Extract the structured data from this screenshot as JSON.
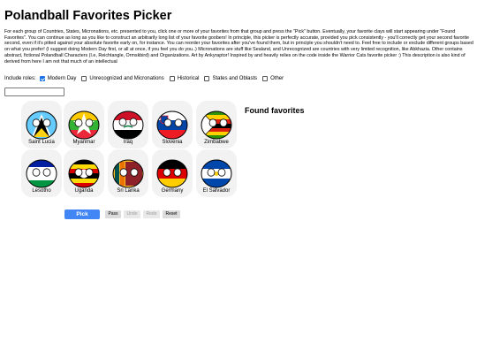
{
  "page": {
    "title": "Polandball Favorites Picker",
    "description": "For each group of Countries, States, Micronations, etc. presented to you, click one or more of your favorites from that group and press the \"Pick\" button. Eventually, your favorite clays will start appearing under \"Found Favorites\". You can continue as long as you like to construct an arbitrarily long list of your favorite goobers! In principle, this picker is perfectly accurate, provided you pick consistently - you'll correctly get your second favorite second, even if it's pitted against your absolute favorite early on, for instance. You can reorder your favorites after you've found them, but in principle you shouldn't need to. Feel free to include or exclude different groups based on what you prefer! (I suggest doing Modern Day first, or all at once, if you feel you do you..) Micronations are stuff like Sealand, and Unrecognized are countries with very limited recognition, like Abkhazia. Other contains abstract, fictional Polandball Characters (I.e, Reichtangle, Ormskbird) and Organizations. Art by Ankyraptor! Inspired by and heavily relies on the code inside the Warrior Cats favorite picker :) This description is also kind of derived from here I am not that much of an intellectual"
  },
  "roles": {
    "label": "Include roles:",
    "options": [
      {
        "label": "Modern Day",
        "checked": true
      },
      {
        "label": "Unrecognized and Micronations",
        "checked": false
      },
      {
        "label": "Historical",
        "checked": false
      },
      {
        "label": "States and Oblasts",
        "checked": false
      },
      {
        "label": "Other",
        "checked": false
      }
    ]
  },
  "search": {
    "value": "",
    "placeholder": ""
  },
  "candidates": [
    {
      "name": "Saint Lucia"
    },
    {
      "name": "Myanmar"
    },
    {
      "name": "Iraq"
    },
    {
      "name": "Slovenia"
    },
    {
      "name": "Zimbabwe"
    },
    {
      "name": "Lesotho"
    },
    {
      "name": "Uganda"
    },
    {
      "name": "Sri Lanka"
    },
    {
      "name": "Germany"
    },
    {
      "name": "El Salvador"
    }
  ],
  "found": {
    "heading": "Found favorites"
  },
  "buttons": {
    "pick": "Pick",
    "pass": "Pass",
    "undo": "Undo",
    "redo": "Redo",
    "reset": "Reset"
  },
  "colors": {
    "accent": "#4285f4",
    "card": "#f2f2f2",
    "checkbox": "#1a73e8"
  }
}
